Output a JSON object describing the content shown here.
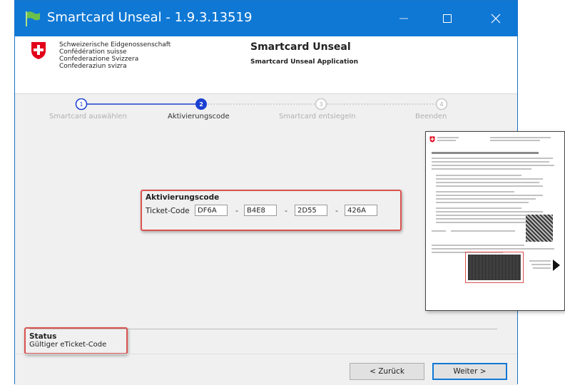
{
  "window": {
    "title": "Smartcard Unseal - 1.9.3.13519"
  },
  "header": {
    "authority_lines": [
      "Schweizerische Eidgenossenschaft",
      "Confédération suisse",
      "Confederazione Svizzera",
      "Confederaziun svizra"
    ],
    "title": "Smartcard Unseal",
    "subtitle": "Smartcard Unseal Application"
  },
  "steps": [
    {
      "number": "1",
      "label": "Smartcard auswählen",
      "state": "done"
    },
    {
      "number": "2",
      "label": "Aktivierungscode",
      "state": "active"
    },
    {
      "number": "3",
      "label": "Smartcard entsiegeln",
      "state": "pending"
    },
    {
      "number": "4",
      "label": "Beenden",
      "state": "pending"
    }
  ],
  "activation": {
    "group_title": "Aktivierungscode",
    "field_label": "Ticket-Code",
    "codes": [
      "DF6A",
      "B4E8",
      "2D55",
      "426A"
    ],
    "separator": "-"
  },
  "status": {
    "title": "Status",
    "text": "Gültiger eTicket-Code"
  },
  "buttons": {
    "back": "< Zurück",
    "next": "Weiter >"
  },
  "colors": {
    "titlebar": "#0f78d4",
    "step_active": "#1a3fd1",
    "highlight": "#d9534f",
    "swiss_red": "#e2001a"
  }
}
